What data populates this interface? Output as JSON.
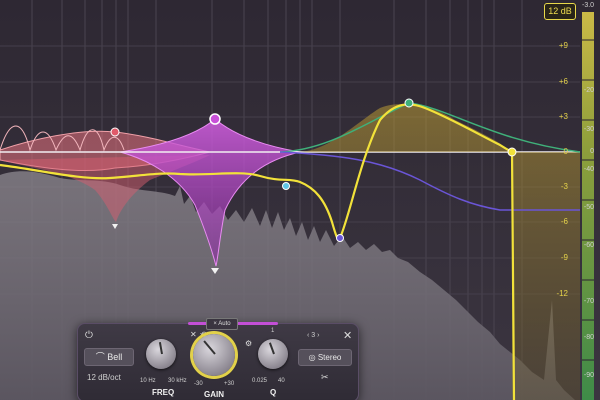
{
  "range_badge": "12 dB",
  "top_right_value": "-3.0",
  "gain_scale": [
    {
      "label": "+9",
      "value": 9
    },
    {
      "label": "+6",
      "value": 6
    },
    {
      "label": "+3",
      "value": 3
    },
    {
      "label": "0",
      "value": 0
    },
    {
      "label": "-3",
      "value": -3
    },
    {
      "label": "-6",
      "value": -6
    },
    {
      "label": "-9",
      "value": -9
    },
    {
      "label": "-12",
      "value": -12
    }
  ],
  "db_scale": [
    {
      "label": "-20",
      "value": -20
    },
    {
      "label": "-30",
      "value": -30
    },
    {
      "label": "0",
      "value": 0
    },
    {
      "label": "-40",
      "value": -40
    },
    {
      "label": "-50",
      "value": -50
    },
    {
      "label": "-60",
      "value": -60
    },
    {
      "label": "-70",
      "value": -70
    },
    {
      "label": "-80",
      "value": -80
    },
    {
      "label": "-90",
      "value": -90
    }
  ],
  "colors": {
    "band_pink": "#e8737f",
    "band_magenta": "#c850d8",
    "band_yellow": "#f2e23a",
    "band_green": "#3fb07a",
    "band_blue": "#6a55d6",
    "band_cyan": "#5fc6e6",
    "spectrum": "#8f8a92",
    "meter_green": "#3f9a4a"
  },
  "panel": {
    "shape": "Bell",
    "slope": "12 dB/oct",
    "auto_label": "Auto",
    "band_number": "3",
    "stereo_label": "Stereo",
    "freq": {
      "label": "FREQ",
      "min": "10 Hz",
      "max": "30 kHz"
    },
    "gain": {
      "label": "GAIN",
      "min": "-30",
      "max": "+30"
    },
    "q": {
      "label": "Q",
      "min": "0.025",
      "max": "40",
      "top": "1"
    }
  }
}
